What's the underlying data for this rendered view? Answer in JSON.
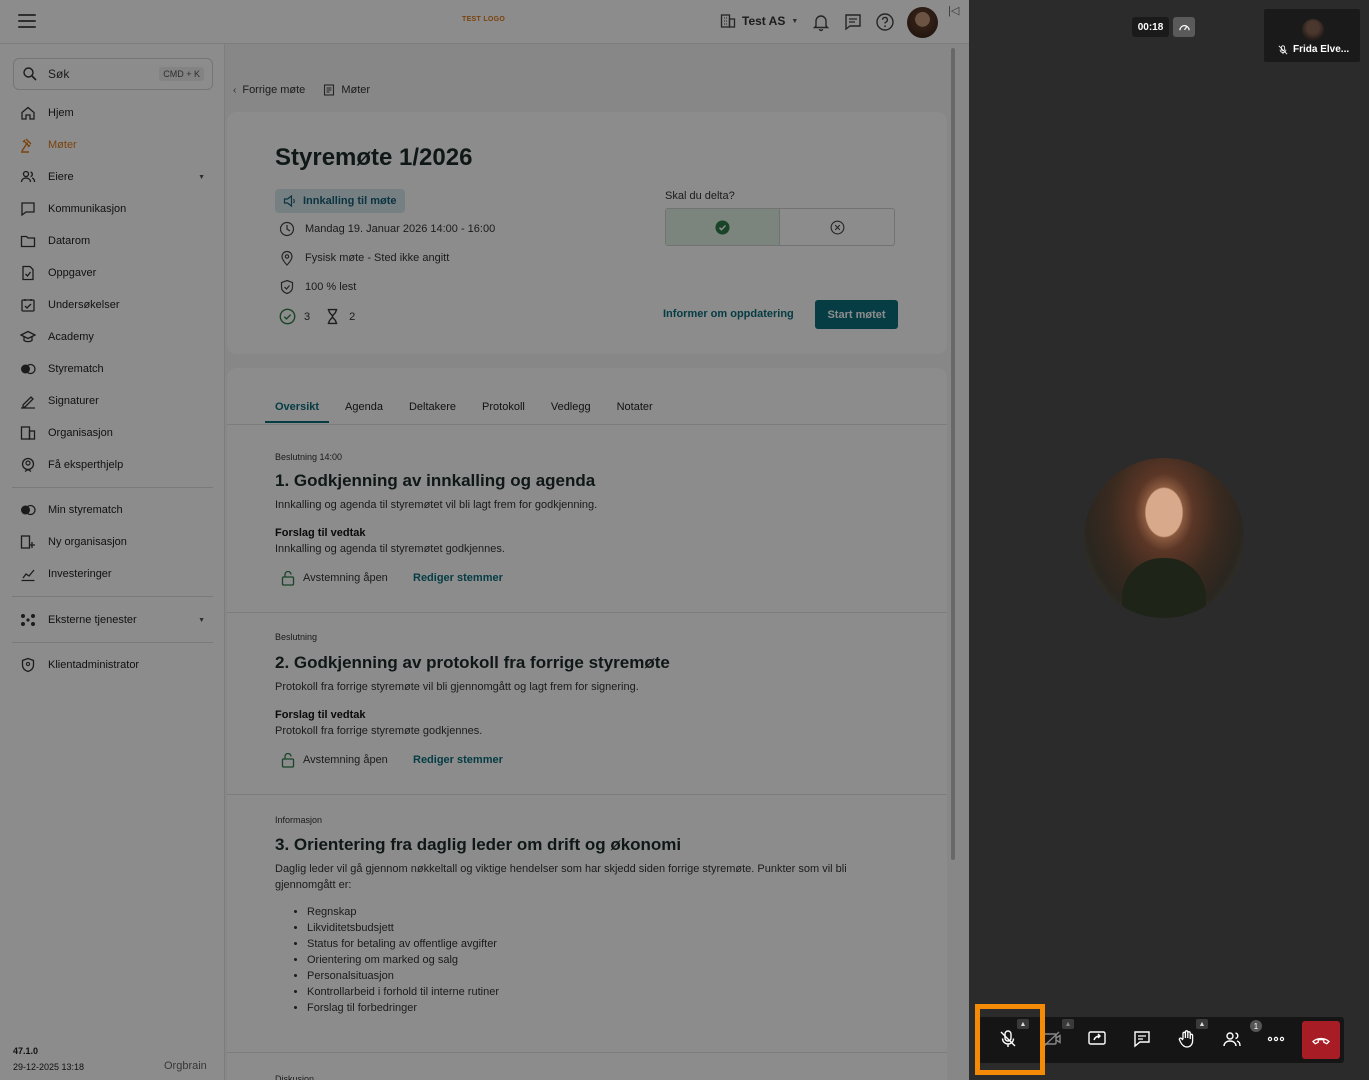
{
  "topbar": {
    "logo_text": "TEST LOGO",
    "org_name": "Test AS"
  },
  "sidebar": {
    "search_placeholder": "Søk",
    "search_shortcut": "CMD + K",
    "items": [
      {
        "label": "Hjem",
        "icon": "home-icon"
      },
      {
        "label": "Møter",
        "icon": "gavel-icon",
        "active": true
      },
      {
        "label": "Eiere",
        "icon": "people-icon",
        "expandable": true
      },
      {
        "label": "Kommunikasjon",
        "icon": "chat-icon"
      },
      {
        "label": "Datarom",
        "icon": "folder-icon"
      },
      {
        "label": "Oppgaver",
        "icon": "task-icon"
      },
      {
        "label": "Undersøkelser",
        "icon": "survey-icon"
      },
      {
        "label": "Academy",
        "icon": "academy-icon"
      },
      {
        "label": "Styrematch",
        "icon": "match-icon"
      },
      {
        "label": "Signaturer",
        "icon": "pen-icon"
      },
      {
        "label": "Organisasjon",
        "icon": "building-icon"
      },
      {
        "label": "Få eksperthjelp",
        "icon": "expert-icon"
      }
    ],
    "items2": [
      {
        "label": "Min styrematch",
        "icon": "toggle-icon"
      },
      {
        "label": "Ny organisasjon",
        "icon": "building-plus-icon"
      },
      {
        "label": "Investeringer",
        "icon": "chart-icon"
      }
    ],
    "external": "Eksterne tjenester",
    "client_admin": "Klientadministrator",
    "version": "47.1.0",
    "version_date": "29-12-2025 13:18",
    "brand": "Orgbrain"
  },
  "breadcrumbs": {
    "back": "Forrige møte",
    "meetings": "Møter"
  },
  "meeting": {
    "title": "Styremøte 1/2026",
    "badge": "Innkalling til møte",
    "datetime": "Mandag 19. Januar 2026 14:00 - 16:00",
    "location": "Fysisk møte - Sted ikke angitt",
    "read": "100 % lest",
    "accepted_count": "3",
    "pending_count": "2",
    "rsvp_label": "Skal du delta?",
    "inform_link": "Informer om oppdatering",
    "start_button": "Start møtet"
  },
  "tabs": [
    "Oversikt",
    "Agenda",
    "Deltakere",
    "Protokoll",
    "Vedlegg",
    "Notater"
  ],
  "agenda": [
    {
      "kind": "Beslutning 14:00",
      "title": "1. Godkjenning av innkalling og agenda",
      "desc": "Innkalling og agenda til styremøtet vil bli lagt frem for godkjenning.",
      "proposal_label": "Forslag til vedtak",
      "proposal": "Innkalling og agenda til styremøtet godkjennes.",
      "vote_status": "Avstemning åpen",
      "edit_votes": "Rediger stemmer"
    },
    {
      "kind": "Beslutning",
      "title": "2. Godkjenning av protokoll fra forrige styremøte",
      "desc": "Protokoll fra forrige styremøte vil bli gjennomgått og lagt frem for signering.",
      "proposal_label": "Forslag til vedtak",
      "proposal": "Protokoll fra forrige styremøte godkjennes.",
      "vote_status": "Avstemning åpen",
      "edit_votes": "Rediger stemmer"
    },
    {
      "kind": "Informasjon",
      "title": "3. Orientering fra daglig leder om drift og økonomi",
      "desc": "Daglig leder vil gå gjennom nøkkeltall og viktige hendelser som har skjedd siden forrige styremøte. Punkter som vil bli gjennomgått er:",
      "bullets": [
        "Regnskap",
        "Likviditetsbudsjett",
        "Status for betaling av offentlige avgifter",
        "Orientering om marked og salg",
        "Personalsituasjon",
        "Kontrollarbeid i forhold til interne rutiner",
        "Forslag til forbedringer"
      ]
    },
    {
      "kind": "Diskusjon"
    }
  ],
  "video": {
    "timer": "00:18",
    "participant_name": "Frida Elve...",
    "participants_count": "1"
  },
  "colors": {
    "accent": "#0b6e7d",
    "active_nav": "#e07b1a",
    "hangup": "#a81d25",
    "highlight": "#f58a06"
  }
}
